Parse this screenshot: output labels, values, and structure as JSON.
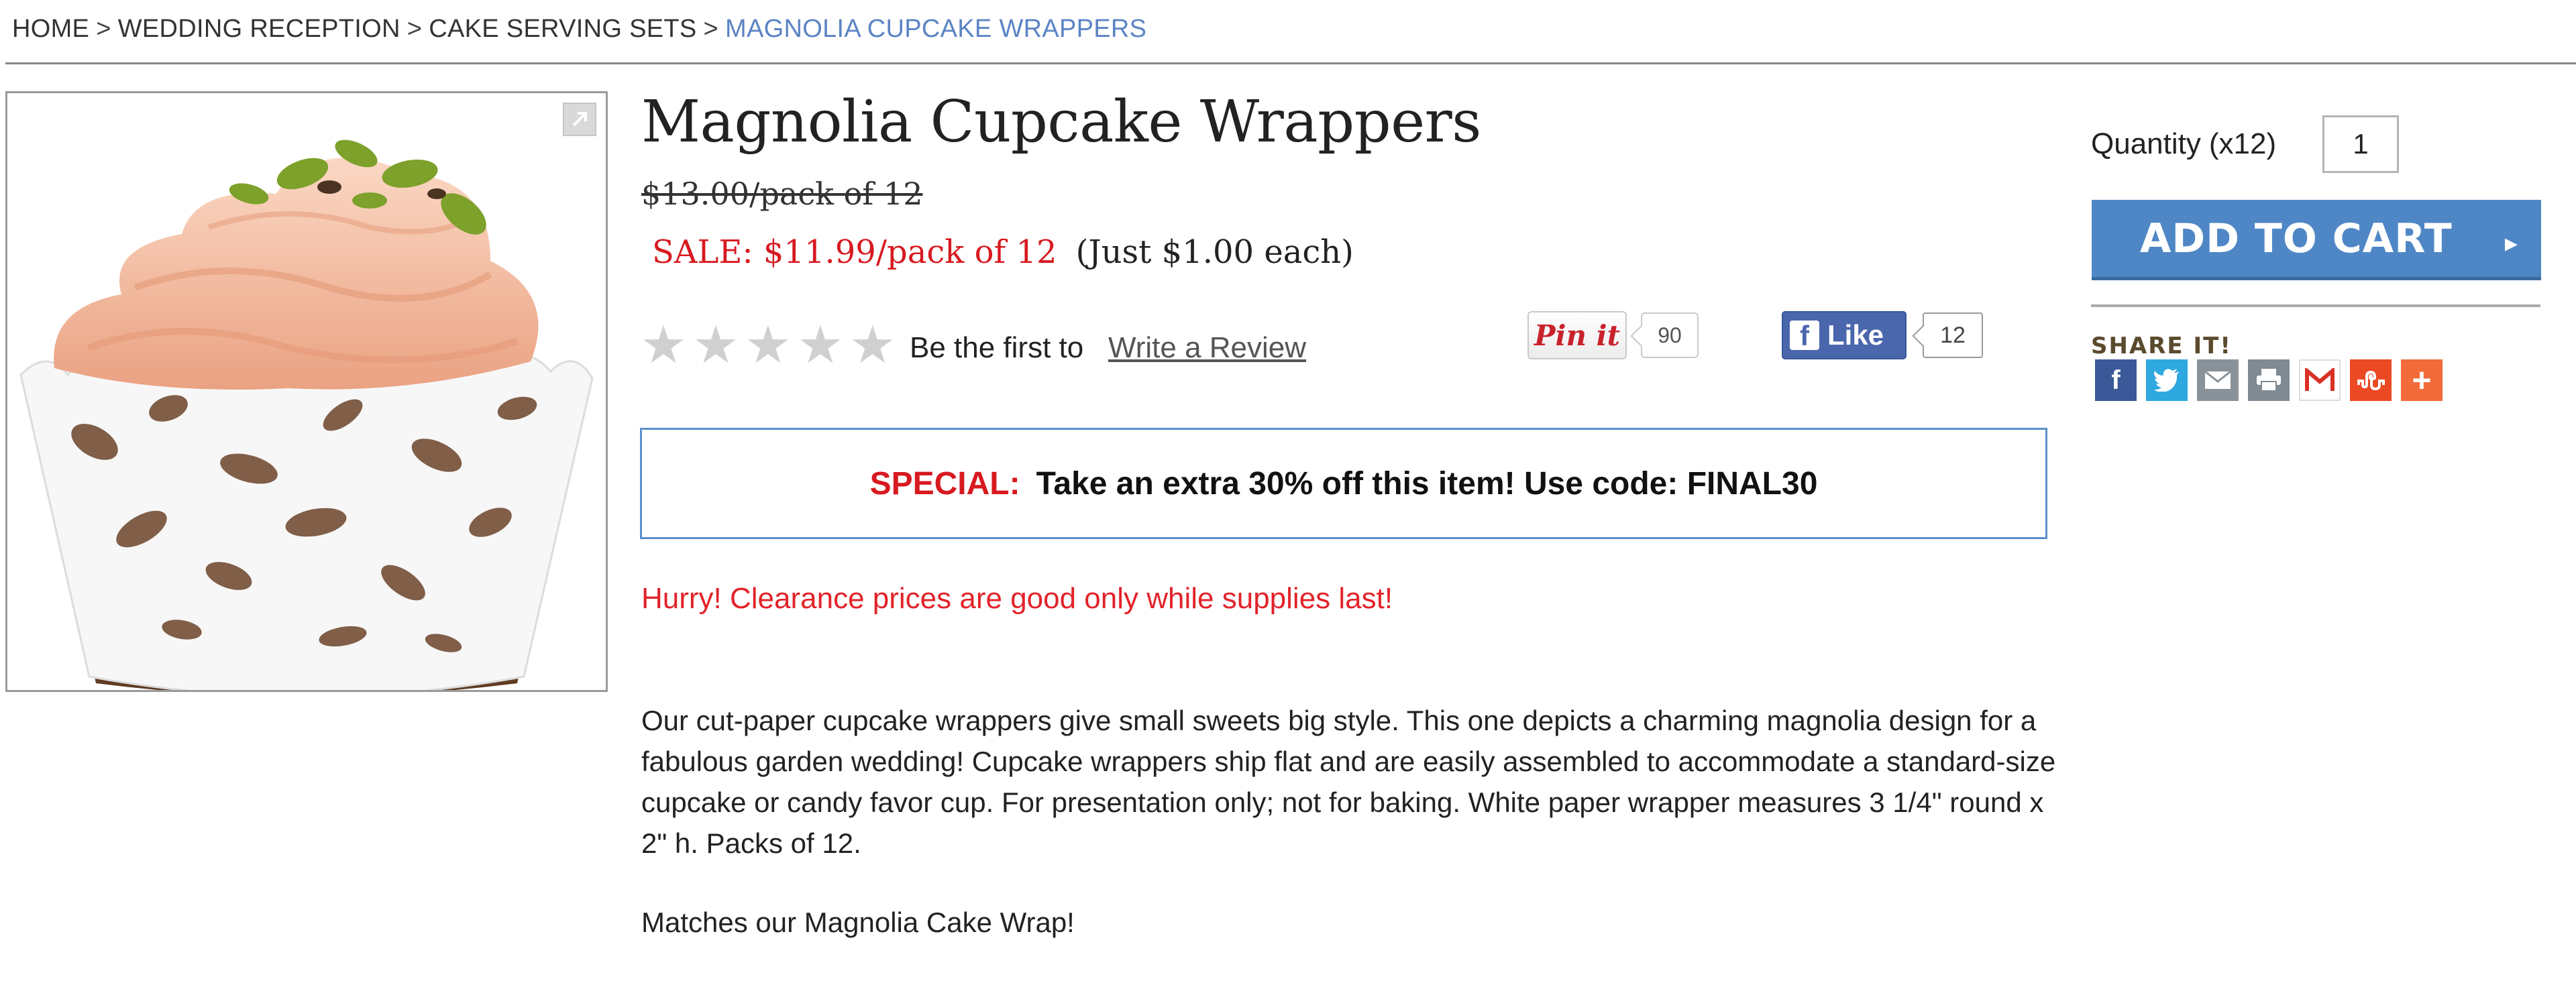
{
  "breadcrumb": {
    "items": [
      "HOME",
      "WEDDING RECEPTION",
      "CAKE SERVING SETS"
    ],
    "current": "MAGNOLIA CUPCAKE WRAPPERS",
    "separator": ">"
  },
  "product": {
    "title": "Magnolia Cupcake Wrappers",
    "old_price": "$13.00/pack of 12",
    "sale_price": "SALE: $11.99/pack of 12",
    "each_price": "(Just $1.00 each)",
    "image_icon": "cupcake-wrapper-photo"
  },
  "rating": {
    "stars": 5,
    "first_text": "Be the first to",
    "review_link": "Write a Review"
  },
  "social": {
    "pinit_label": "Pin it",
    "pin_count": "90",
    "fb_label": "Like",
    "fb_count": "12"
  },
  "special": {
    "label": "SPECIAL:",
    "text": "Take an extra 30% off this item! Use code: FINAL30"
  },
  "hurry": "Hurry! Clearance prices are good only while supplies last!",
  "description": "Our cut-paper cupcake wrappers give small sweets big style. This one depicts a charming magnolia design for a fabulous garden wedding! Cupcake wrappers ship flat and are easily assembled to accommodate a standard-size cupcake or candy favor cup. For presentation only; not for baking. White paper wrapper measures 3 1/4\" round x 2\" h. Packs of 12.",
  "matches": "Matches our Magnolia Cake Wrap!",
  "purchase": {
    "quantity_label": "Quantity",
    "quantity_unit": "(x12)",
    "quantity_value": "1",
    "add_to_cart": "ADD TO CART"
  },
  "share": {
    "label": "SHARE IT!",
    "icons": [
      {
        "name": "facebook-icon",
        "color": "#3b5998",
        "glyph": "f"
      },
      {
        "name": "twitter-icon",
        "color": "#2fa8e0",
        "glyph": "t"
      },
      {
        "name": "email-icon",
        "color": "#8a9299",
        "glyph": "✉"
      },
      {
        "name": "print-icon",
        "color": "#7f8a93",
        "glyph": "⎙"
      },
      {
        "name": "gmail-icon",
        "color": "#ffffff",
        "glyph": "M"
      },
      {
        "name": "stumbleupon-icon",
        "color": "#eb4924",
        "glyph": "su"
      },
      {
        "name": "more-icon",
        "color": "#f26b3a",
        "glyph": "+"
      }
    ]
  },
  "colors": {
    "sale_red": "#d71920",
    "link_blue": "#5b84c4",
    "button_blue": "#4f87c6",
    "facebook_blue": "#4a66ad"
  }
}
